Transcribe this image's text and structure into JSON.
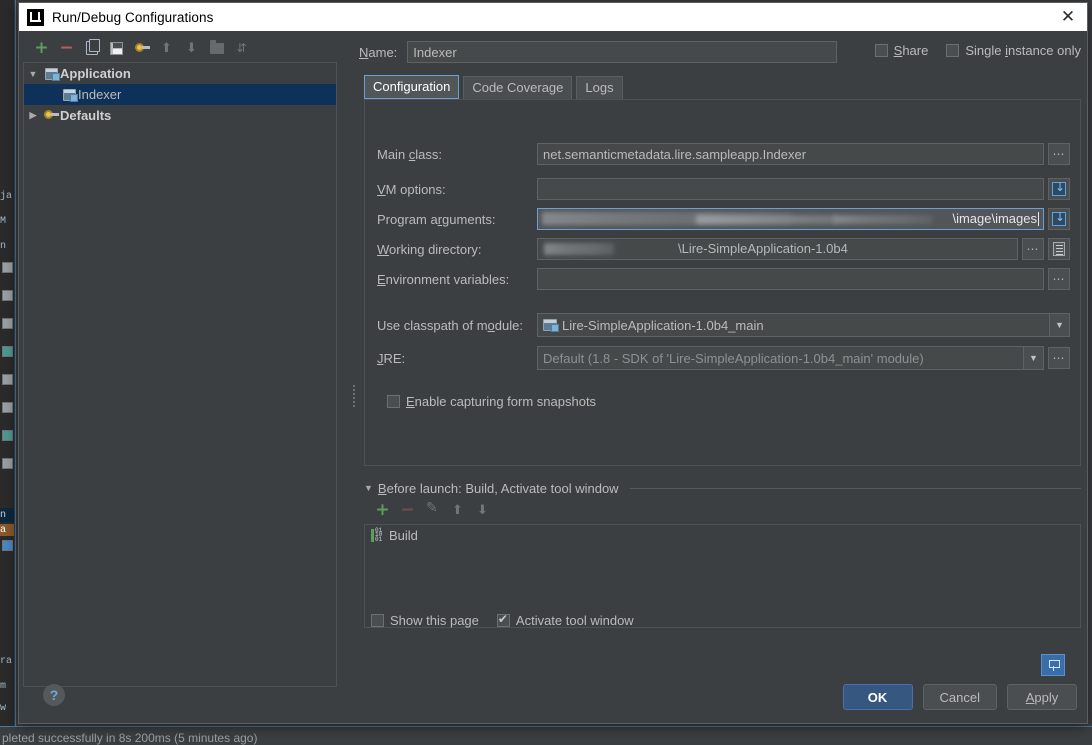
{
  "window": {
    "title": "Run/Debug Configurations",
    "logo_icon": "intellij-idea-logo-icon",
    "close_icon": "close-icon"
  },
  "tree_toolbar": {
    "buttons": [
      {
        "name": "add-configuration-button",
        "icon": "plus-icon",
        "enabled": true
      },
      {
        "name": "remove-configuration-button",
        "icon": "minus-icon",
        "enabled": true
      },
      {
        "name": "copy-configuration-button",
        "icon": "copy-icon",
        "enabled": true
      },
      {
        "name": "save-configuration-button",
        "icon": "save-icon",
        "enabled": true
      },
      {
        "name": "edit-defaults-button",
        "icon": "wrench-icon",
        "enabled": true
      },
      {
        "name": "move-up-button",
        "icon": "arrow-up-icon",
        "enabled": false
      },
      {
        "name": "move-down-button",
        "icon": "arrow-down-icon",
        "enabled": false
      },
      {
        "name": "create-folder-button",
        "icon": "folder-icon",
        "enabled": false
      },
      {
        "name": "sort-configurations-button",
        "icon": "sort-icon",
        "enabled": false
      }
    ]
  },
  "tree": {
    "nodes": [
      {
        "label": "Application",
        "icon": "application-icon",
        "expanded": true,
        "selected": false,
        "level": 0,
        "has_toggle": true
      },
      {
        "label": "Indexer",
        "icon": "application-icon",
        "expanded": false,
        "selected": true,
        "level": 1,
        "has_toggle": false
      },
      {
        "label": "Defaults",
        "icon": "wrench-icon",
        "expanded": false,
        "selected": false,
        "level": 0,
        "has_toggle": true
      }
    ]
  },
  "name_row": {
    "label": "Name:",
    "value": "Indexer",
    "placeholder": ""
  },
  "options": {
    "share": {
      "label": "Share",
      "checked": false
    },
    "single_instance": {
      "label": "Single instance only",
      "checked": false
    }
  },
  "tabs": [
    {
      "label": "Configuration",
      "active": true
    },
    {
      "label": "Code Coverage",
      "active": false
    },
    {
      "label": "Logs",
      "active": false
    }
  ],
  "fields": {
    "main_class": {
      "label": "Main class:",
      "value": "net.semanticmetadata.lire.sampleapp.Indexer",
      "browse_icon": "ellipsis-icon"
    },
    "vm_options": {
      "label": "VM options:",
      "value": "",
      "expand_icon": "expand-editor-icon"
    },
    "program_arguments": {
      "label": "Program arguments:",
      "value": "\\image\\images",
      "redacted": true,
      "focused": true,
      "expand_icon": "expand-editor-icon"
    },
    "working_directory": {
      "label": "Working directory:",
      "value": "\\Lire-SimpleApplication-1.0b4",
      "redacted": true,
      "browse_icon": "ellipsis-icon",
      "macro_icon": "macro-list-icon"
    },
    "environment_variables": {
      "label": "Environment variables:",
      "value": "",
      "browse_icon": "ellipsis-icon"
    },
    "classpath_module": {
      "label": "Use classpath of module:",
      "value": "Lire-SimpleApplication-1.0b4_main",
      "icon": "module-icon",
      "dropdown_icon": "chevron-down-icon"
    },
    "jre": {
      "label": "JRE:",
      "value": "Default (1.8 - SDK of 'Lire-SimpleApplication-1.0b4_main' module)",
      "dropdown_icon": "chevron-down-icon",
      "browse_icon": "ellipsis-icon"
    },
    "form_snapshots": {
      "label": "Enable capturing form snapshots",
      "checked": false
    }
  },
  "before_launch": {
    "title": "Before launch: Build, Activate tool window",
    "expanded": true,
    "toolbar": [
      {
        "name": "add-task-button",
        "icon": "plus-icon",
        "enabled": true
      },
      {
        "name": "remove-task-button",
        "icon": "minus-icon",
        "enabled": false
      },
      {
        "name": "edit-task-button",
        "icon": "pencil-icon",
        "enabled": false
      },
      {
        "name": "move-task-up-button",
        "icon": "arrow-up-icon",
        "enabled": false
      },
      {
        "name": "move-task-down-button",
        "icon": "arrow-down-icon",
        "enabled": false
      }
    ],
    "items": [
      {
        "label": "Build",
        "icon": "build-icon"
      }
    ],
    "checkboxes": [
      {
        "name": "show-this-page-checkbox",
        "label": "Show this page",
        "checked": false
      },
      {
        "name": "activate-tool-window-checkbox",
        "label": "Activate tool window",
        "checked": true
      }
    ]
  },
  "footer": {
    "help_icon": "help-question-icon",
    "pin_icon": "pin-icon",
    "buttons": [
      {
        "name": "ok-button",
        "label": "OK",
        "primary": true
      },
      {
        "name": "cancel-button",
        "label": "Cancel",
        "primary": false
      },
      {
        "name": "apply-button",
        "label": "Apply",
        "primary": false
      }
    ]
  },
  "statusbar": {
    "text": "pleted successfully in 8s 200ms (5 minutes ago)"
  },
  "colors": {
    "dialog_bg": "#3c3f41",
    "field_bg": "#45494a",
    "selection_blue": "#0d3158",
    "accent_blue": "#4b6eaf",
    "primary_button": "#365880",
    "text": "#bbbbbb",
    "titlebar_bg": "#ffffff",
    "green": "#5aa05a",
    "red": "#c05a5a"
  }
}
